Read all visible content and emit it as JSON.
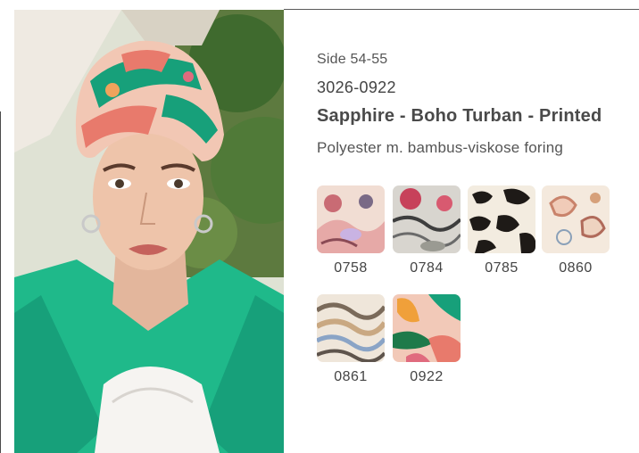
{
  "product": {
    "side_ref": "Side 54-55",
    "sku": "3026-0922",
    "title": "Sapphire - Boho Turban - Printed",
    "material": "Polyester m. bambus-viskose foring"
  },
  "colors": {
    "jacket": "#1fb98a",
    "accent_pink": "#e87a6c",
    "accent_green": "#17a07a"
  },
  "swatches": [
    {
      "code": "0758"
    },
    {
      "code": "0784"
    },
    {
      "code": "0785"
    },
    {
      "code": "0860"
    },
    {
      "code": "0861"
    },
    {
      "code": "0922"
    }
  ]
}
